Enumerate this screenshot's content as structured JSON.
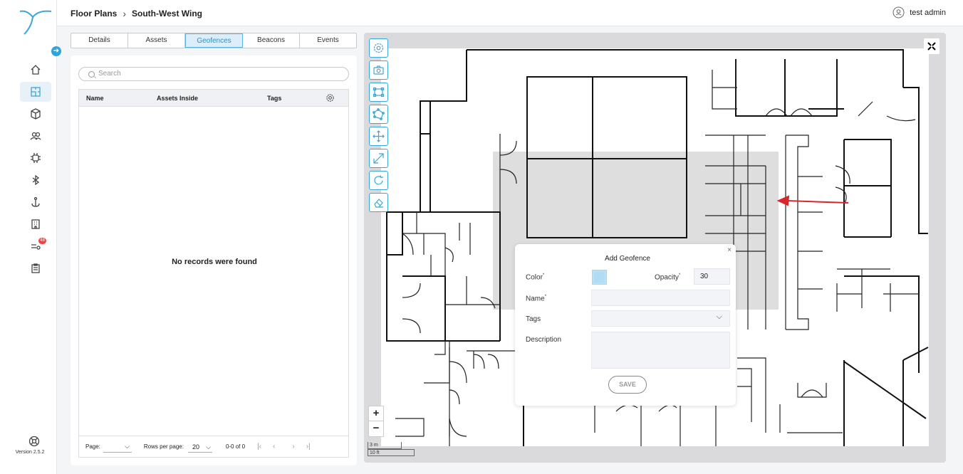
{
  "header": {
    "breadcrumb": [
      "Floor Plans",
      "South-West Wing"
    ],
    "user_name": "test admin"
  },
  "sidebar": {
    "items": [
      {
        "icon": "home-icon"
      },
      {
        "icon": "floor-plan-icon",
        "active": true
      },
      {
        "icon": "cube-icon"
      },
      {
        "icon": "users-icon"
      },
      {
        "icon": "chip-icon"
      },
      {
        "icon": "bluetooth-icon"
      },
      {
        "icon": "anchor-icon"
      },
      {
        "icon": "building-icon"
      },
      {
        "icon": "alerts-icon",
        "badge": "48"
      },
      {
        "icon": "reports-icon"
      }
    ],
    "version": "Version 2.5.2"
  },
  "tabs": [
    "Details",
    "Assets",
    "Geofences",
    "Beacons",
    "Events"
  ],
  "active_tab": "Geofences",
  "search": {
    "placeholder": "Search"
  },
  "table": {
    "columns": [
      "Name",
      "Assets Inside",
      "Tags"
    ],
    "empty_message": "No records were found"
  },
  "pagination": {
    "page_label": "Page:",
    "page_value": "",
    "rows_label": "Rows per page:",
    "rows_value": "20",
    "range": "0-0 of 0"
  },
  "map": {
    "scale_metric": "3 m",
    "scale_imperial": "10 ft",
    "tools": [
      "settings-icon",
      "camera-icon",
      "rectangle-draw-icon",
      "polygon-draw-icon",
      "move-icon",
      "resize-icon",
      "rotate-icon",
      "eraser-icon"
    ]
  },
  "dialog": {
    "title": "Add Geofence",
    "color_label": "Color",
    "opacity_label": "Opacity",
    "opacity_value": "30",
    "name_label": "Name",
    "tags_label": "Tags",
    "description_label": "Description",
    "save_label": "SAVE",
    "swatch_color": "#b9e1f6"
  },
  "colors": {
    "accent": "#3ba7d8",
    "geofence_fill": "#d8d8d8",
    "arrow": "#d9262b"
  }
}
